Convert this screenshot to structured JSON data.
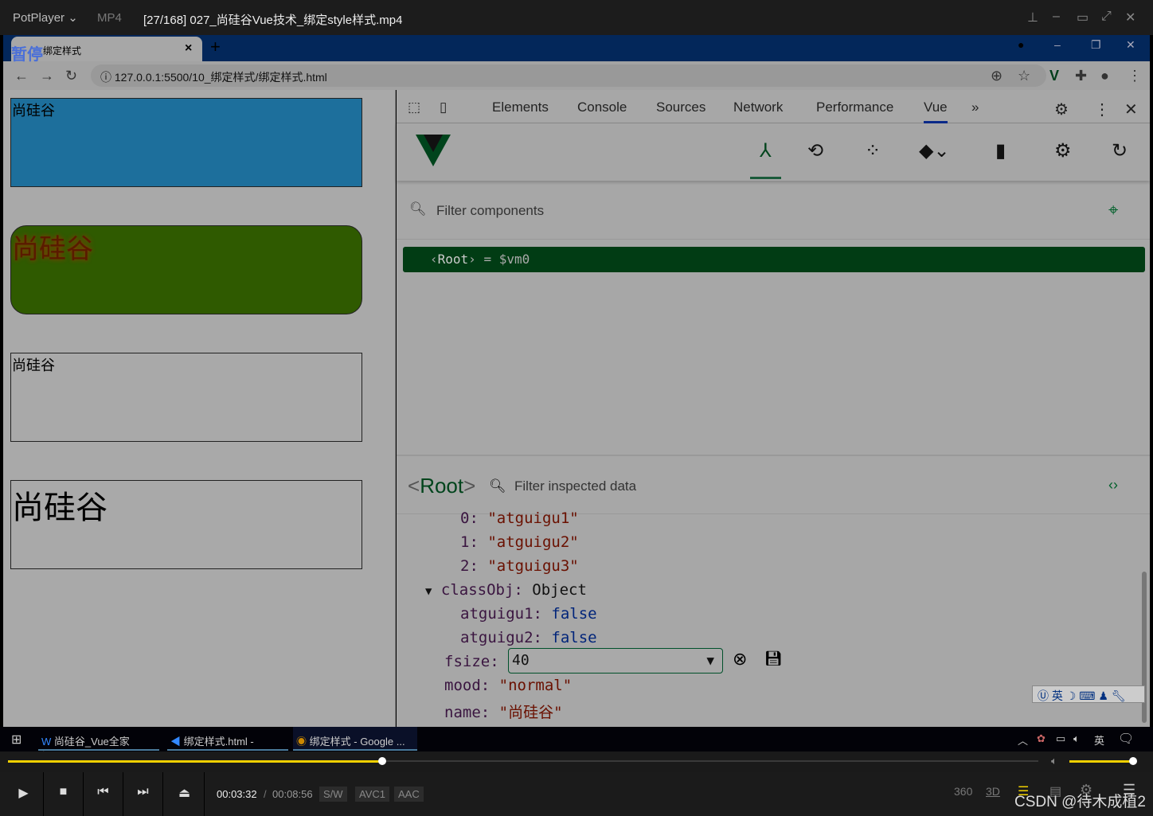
{
  "player": {
    "brand": "PotPlayer",
    "format": "MP4",
    "title": "[27/168] 027_尚硅谷Vue技术_绑定style样式.mp4",
    "pause_label": "暂停",
    "time_current": "00:03:32",
    "time_total": "00:08:56",
    "badges": [
      "S/W",
      "AVC1",
      "AAC"
    ],
    "progress_percent": 36.3,
    "volume_percent": 100,
    "right_icons": [
      "360",
      "3D"
    ],
    "watermark": "CSDN @待木成植2"
  },
  "browser": {
    "tab_title": "绑定样式",
    "url": "127.0.0.1:5500/10_绑定样式/绑定样式.html"
  },
  "page": {
    "boxes": [
      "尚硅谷",
      "尚硅谷",
      "尚硅谷",
      "尚硅谷"
    ]
  },
  "devtools": {
    "tabs": [
      "Elements",
      "Console",
      "Sources",
      "Network",
      "Performance",
      "Vue"
    ],
    "active_tab": "Vue",
    "filter_components_placeholder": "Filter components",
    "root_row": {
      "name": "Root",
      "suffix": "= $vm0"
    },
    "inspector": {
      "title": "Root",
      "filter_placeholder": "Filter inspected data",
      "rows": [
        {
          "key": "0",
          "value": "\"atguigu1\""
        },
        {
          "key": "1",
          "value": "\"atguigu2\""
        },
        {
          "key": "2",
          "value": "\"atguigu3\""
        }
      ],
      "classObj": {
        "key": "classObj",
        "type": "Object",
        "items": [
          {
            "key": "atguigu1",
            "value": "false"
          },
          {
            "key": "atguigu2",
            "value": "false"
          }
        ]
      },
      "fsize": {
        "key": "fsize",
        "value": "40"
      },
      "mood": {
        "key": "mood",
        "value": "\"normal\""
      },
      "name": {
        "key": "name",
        "value": "\"尚硅谷\""
      }
    }
  },
  "taskbar": {
    "items": [
      "尚硅谷_Vue全家桶.d...",
      "绑定样式.html - vue_...",
      "绑定样式 - Google ..."
    ],
    "ime": "英"
  },
  "colors": {
    "accent": "#f0d000",
    "vue_green": "#00441c"
  }
}
